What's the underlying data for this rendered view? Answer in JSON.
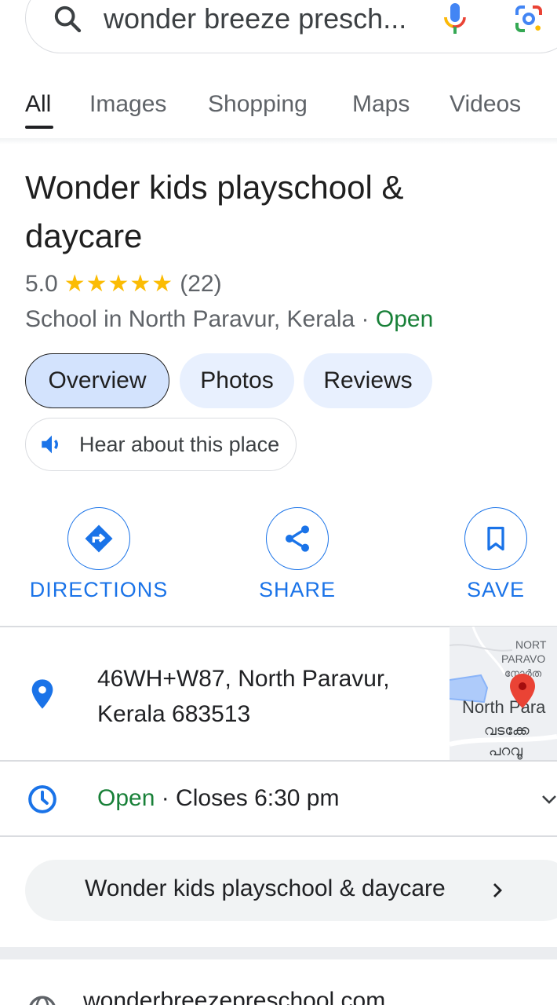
{
  "search": {
    "query": "wonder breeze presch..."
  },
  "tabs": [
    {
      "label": "All",
      "active": true
    },
    {
      "label": "Images"
    },
    {
      "label": "Shopping"
    },
    {
      "label": "Maps"
    },
    {
      "label": "Videos"
    }
  ],
  "place": {
    "name": "Wonder kids playschool & daycare",
    "rating": "5.0",
    "stars": "★★★★★",
    "review_count": "(22)",
    "category_location": "School in North Paravur, Kerala · ",
    "status": "Open"
  },
  "chips": [
    {
      "label": "Overview",
      "selected": true
    },
    {
      "label": "Photos"
    },
    {
      "label": "Reviews"
    }
  ],
  "hear": {
    "label": "Hear about this place"
  },
  "actions": [
    {
      "label": "DIRECTIONS",
      "icon": "directions-icon"
    },
    {
      "label": "SHARE",
      "icon": "share-icon"
    },
    {
      "label": "SAVE",
      "icon": "bookmark-icon"
    }
  ],
  "address": {
    "line1": "46WH+W87, North Paravur,",
    "line2": "Kerala 683513"
  },
  "map": {
    "labels": [
      "NORT",
      "PARAVO",
      "നോർത",
      "North Para",
      "വടക്കേ",
      "പറവൂ"
    ]
  },
  "hours": {
    "status": "Open",
    "detail": " · Closes 6:30 pm"
  },
  "website_pill": {
    "label": "Wonder kids playschool & daycare"
  },
  "website": {
    "url": "wonderbreezepreschool.com"
  },
  "colors": {
    "accent": "#1a73e8",
    "open": "#188038",
    "star": "#fbbc04",
    "pin": "#ea4335"
  }
}
